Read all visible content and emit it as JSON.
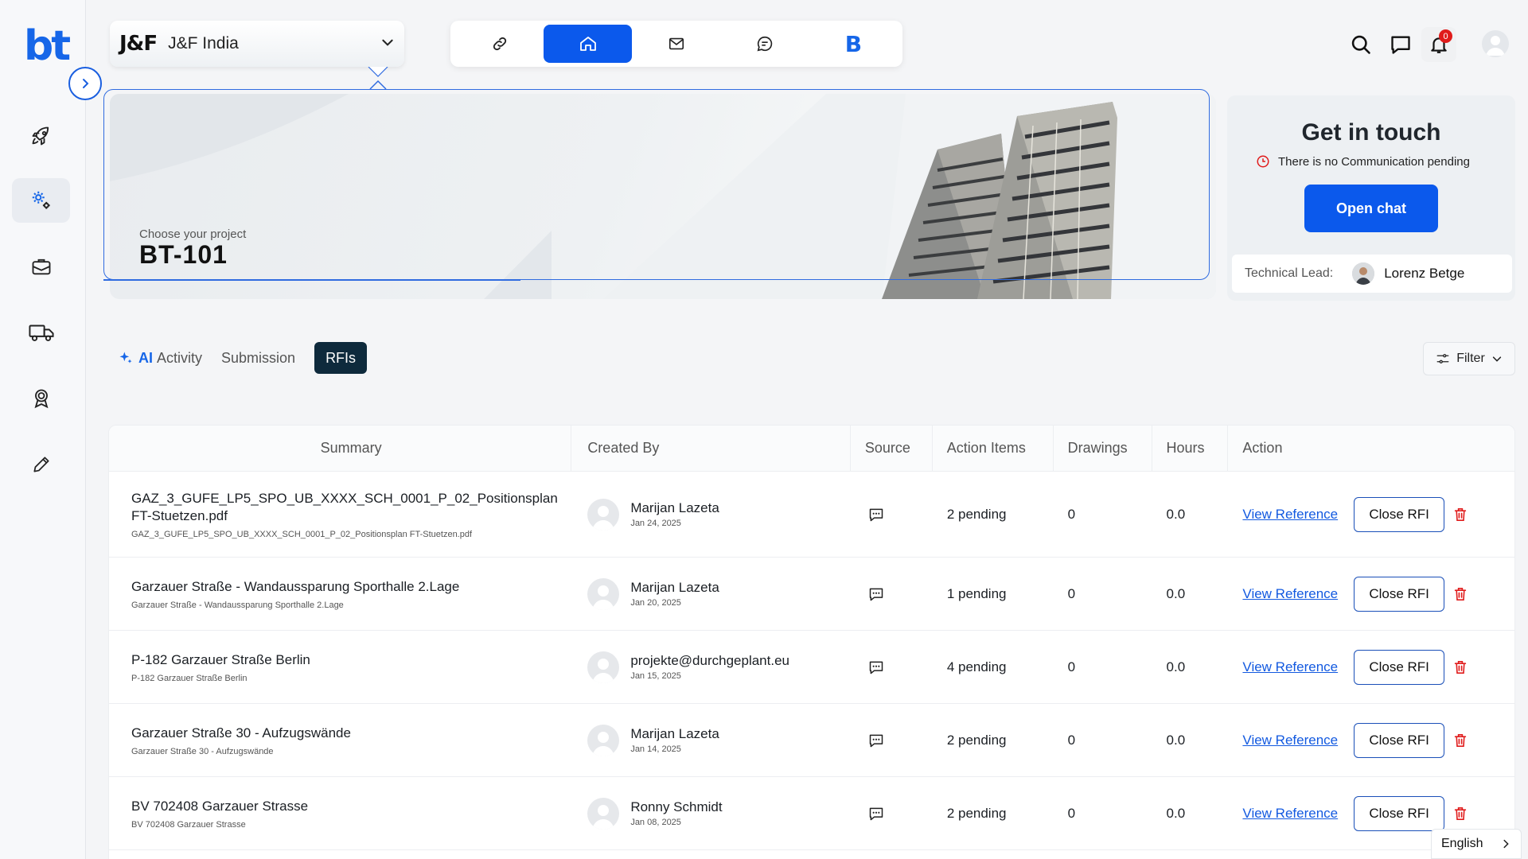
{
  "brand": {
    "logo_text": "bt"
  },
  "company": {
    "logo_text": "J&F",
    "name": "J&F India"
  },
  "topnav": {
    "items": [
      "link-icon",
      "home-icon",
      "mail-icon",
      "chat-bubble-icon",
      "b-brand-icon"
    ],
    "active": "home-icon",
    "b_text": "B"
  },
  "notifications": {
    "count": "0"
  },
  "hero": {
    "label": "Choose your project",
    "project": "BT-101"
  },
  "contact": {
    "title": "Get in touch",
    "status": "There is no Communication pending",
    "button": "Open chat",
    "tech_lead_label": "Technical Lead:",
    "tech_lead_name": "Lorenz Betge"
  },
  "tabs": {
    "ai": "AI",
    "activity": "Activity",
    "submission": "Submission",
    "rfis": "RFIs",
    "active": "RFIs"
  },
  "filter": {
    "label": "Filter"
  },
  "table": {
    "headers": {
      "summary": "Summary",
      "created_by": "Created By",
      "source": "Source",
      "action_items": "Action Items",
      "drawings": "Drawings",
      "hours": "Hours",
      "action": "Action"
    },
    "view_label": "View Reference",
    "close_label": "Close RFI",
    "rows": [
      {
        "title": "GAZ_3_GUFE_LP5_SPO_UB_XXXX_SCH_0001_P_02_Positionsplan FT-Stuetzen.pdf",
        "subtitle": "GAZ_3_GUFE_LP5_SPO_UB_XXXX_SCH_0001_P_02_Positionsplan FT-Stuetzen.pdf",
        "by": "Marijan Lazeta",
        "date": "Jan 24, 2025",
        "action_items": "2 pending",
        "drawings": "0",
        "hours": "0.0"
      },
      {
        "title": "Garzauer Straße - Wandaussparung Sporthalle 2.Lage",
        "subtitle": "Garzauer Straße - Wandaussparung Sporthalle 2.Lage",
        "by": "Marijan Lazeta",
        "date": "Jan 20, 2025",
        "action_items": "1 pending",
        "drawings": "0",
        "hours": "0.0"
      },
      {
        "title": "P-182 Garzauer Straße Berlin",
        "subtitle": "P-182 Garzauer Straße Berlin",
        "by": "projekte@durchgeplant.eu",
        "date": "Jan 15, 2025",
        "action_items": "4 pending",
        "drawings": "0",
        "hours": "0.0"
      },
      {
        "title": "Garzauer Straße 30 - Aufzugswände",
        "subtitle": "Garzauer Straße 30 - Aufzugswände",
        "by": "Marijan Lazeta",
        "date": "Jan 14, 2025",
        "action_items": "2 pending",
        "drawings": "0",
        "hours": "0.0"
      },
      {
        "title": "BV 702408 Garzauer Strasse",
        "subtitle": "BV 702408 Garzauer Strasse",
        "by": "Ronny Schmidt",
        "date": "Jan 08, 2025",
        "action_items": "2 pending",
        "drawings": "0",
        "hours": "0.0"
      }
    ]
  },
  "language": {
    "label": "English"
  },
  "colors": {
    "accent": "#0b59ec",
    "dark_tab": "#0e2a3c",
    "danger": "#e01b1b",
    "link": "#1259e0"
  }
}
